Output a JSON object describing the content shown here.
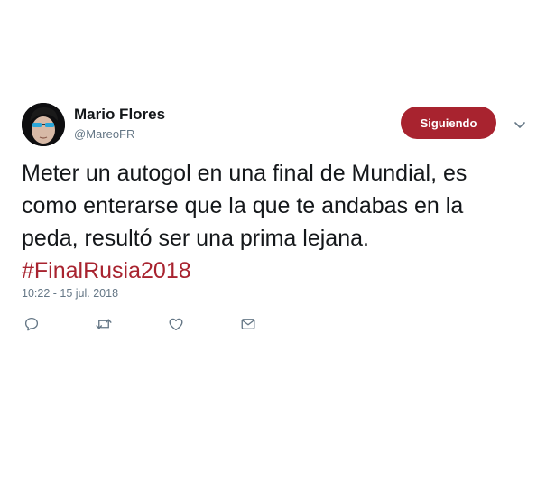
{
  "tweet": {
    "author": {
      "name": "Mario Flores",
      "handle": "@MareoFR"
    },
    "follow_button_label": "Siguiendo",
    "text_lines": [
      "Meter un autogol en una final de Mundial, es",
      "como enterarse que la que te andabas en la",
      "peda, resultó ser una prima lejana."
    ],
    "hashtag": "#FinalRusia2018",
    "timestamp": "10:22 - 15 jul. 2018",
    "actions": [
      {
        "icon": "reply-icon"
      },
      {
        "icon": "retweet-icon"
      },
      {
        "icon": "like-icon"
      },
      {
        "icon": "direct-message-icon"
      }
    ],
    "colors": {
      "accent": "#a8232f",
      "secondary_text": "#657786",
      "primary_text": "#14171a"
    }
  }
}
